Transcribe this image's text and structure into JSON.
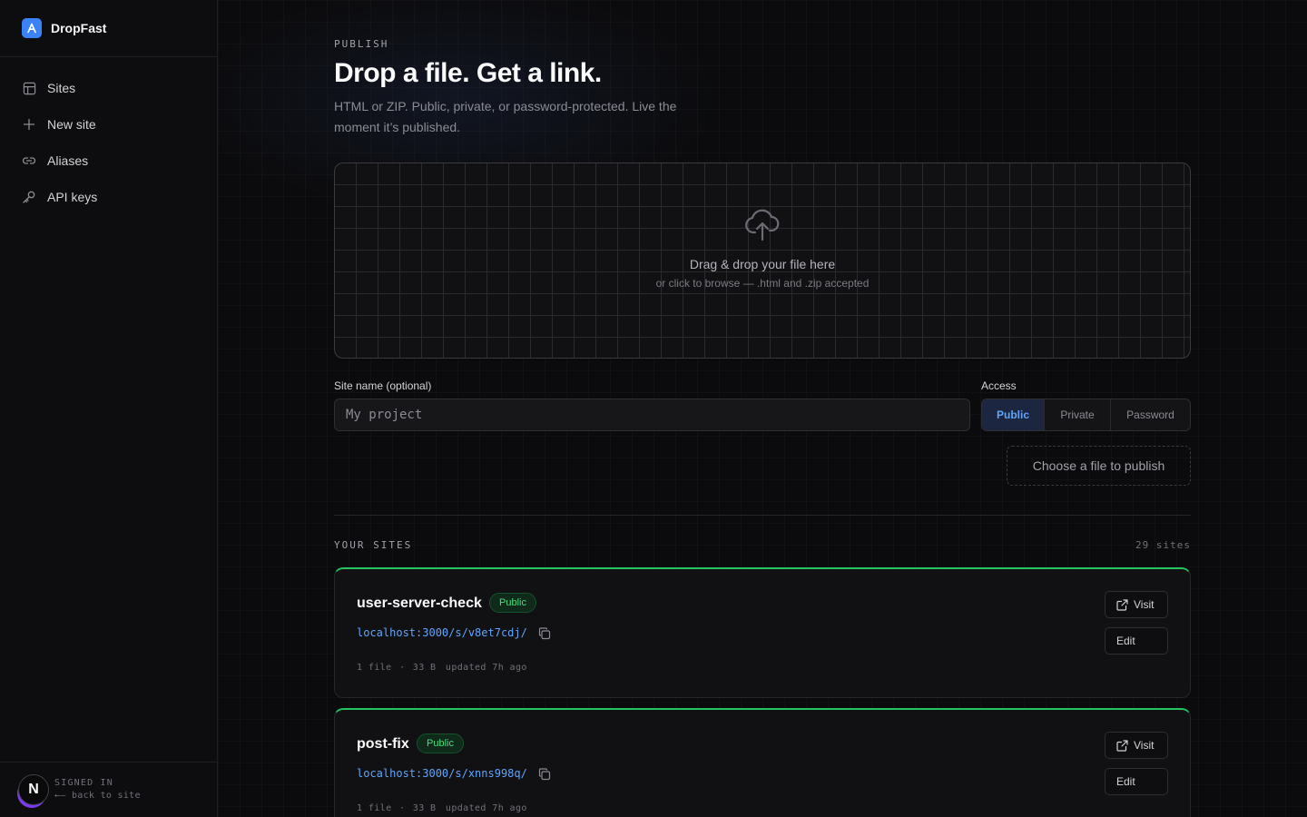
{
  "app": {
    "name": "DropFast",
    "logo_letter": "A"
  },
  "sidebar": {
    "items": [
      {
        "label": "Sites",
        "icon": "grid-icon"
      },
      {
        "label": "New site",
        "icon": "plus-icon"
      },
      {
        "label": "Aliases",
        "icon": "link-icon"
      },
      {
        "label": "API keys",
        "icon": "key-icon"
      }
    ],
    "footer": {
      "avatar_letter": "N",
      "status": "SIGNED IN",
      "back_link": "←— back to site"
    }
  },
  "publish": {
    "eyebrow": "PUBLISH",
    "title": "Drop a file. Get a link.",
    "subtitle": "HTML or ZIP. Public, private, or password-protected. Live the moment it’s published.",
    "dropzone": {
      "icon": "cloud-upload-icon",
      "title": "Drag & drop your file here",
      "subtitle": "or click to browse — .html and .zip accepted"
    },
    "site_name": {
      "label": "Site name (optional)",
      "placeholder": "My project",
      "value": ""
    },
    "access": {
      "label": "Access",
      "options": [
        "Public",
        "Private",
        "Password"
      ],
      "selected": "Public"
    },
    "submit_label": "Choose a file to publish"
  },
  "sites": {
    "heading": "YOUR SITES",
    "count_label": "29 sites",
    "accent_color": "#22c55e",
    "items": [
      {
        "name": "user-server-check",
        "access": "Public",
        "url": "localhost:3000/s/v8et7cdj/",
        "files": "1 file",
        "size": "33 B",
        "updated": "updated 7h ago",
        "visit_label": "Visit",
        "edit_label": "Edit"
      },
      {
        "name": "post-fix",
        "access": "Public",
        "url": "localhost:3000/s/xnns998q/",
        "files": "1 file",
        "size": "33 B",
        "updated": "updated 7h ago",
        "visit_label": "Visit",
        "edit_label": "Edit"
      }
    ]
  },
  "colors": {
    "accent": "#3b82f6",
    "link": "#60a5fa",
    "success": "#22c55e",
    "background": "#0b0b0d"
  }
}
